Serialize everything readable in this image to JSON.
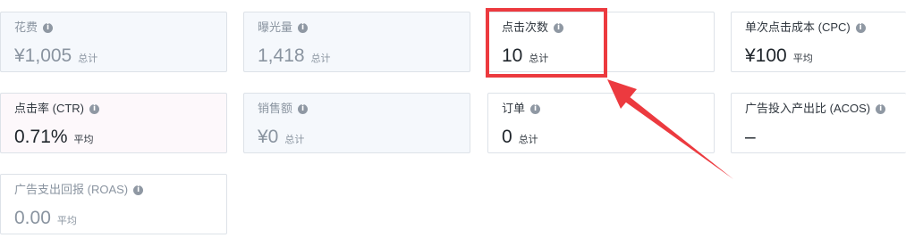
{
  "metrics": [
    {
      "label": "花费",
      "value": "¥1,005",
      "unit": "总计"
    },
    {
      "label": "曝光量",
      "value": "1,418",
      "unit": "总计"
    },
    {
      "label": "点击次数",
      "value": "10",
      "unit": "总计"
    },
    {
      "label": "单次点击成本 (CPC)",
      "value": "¥100",
      "unit": "平均"
    },
    {
      "label": "点击率 (CTR)",
      "value": "0.71%",
      "unit": "平均"
    },
    {
      "label": "销售额",
      "value": "¥0",
      "unit": "总计"
    },
    {
      "label": "订单",
      "value": "0",
      "unit": "总计"
    },
    {
      "label": "广告投入产出比 (ACOS)",
      "value": "–",
      "unit": ""
    },
    {
      "label": "广告支出回报 (ROAS)",
      "value": "0.00",
      "unit": "平均"
    }
  ],
  "info_icon_glyph": "i",
  "colors": {
    "highlight": "#ec3a3f",
    "card_border": "#dde2e8",
    "muted_text": "#8a94a0",
    "dark_text": "#1f252b"
  }
}
